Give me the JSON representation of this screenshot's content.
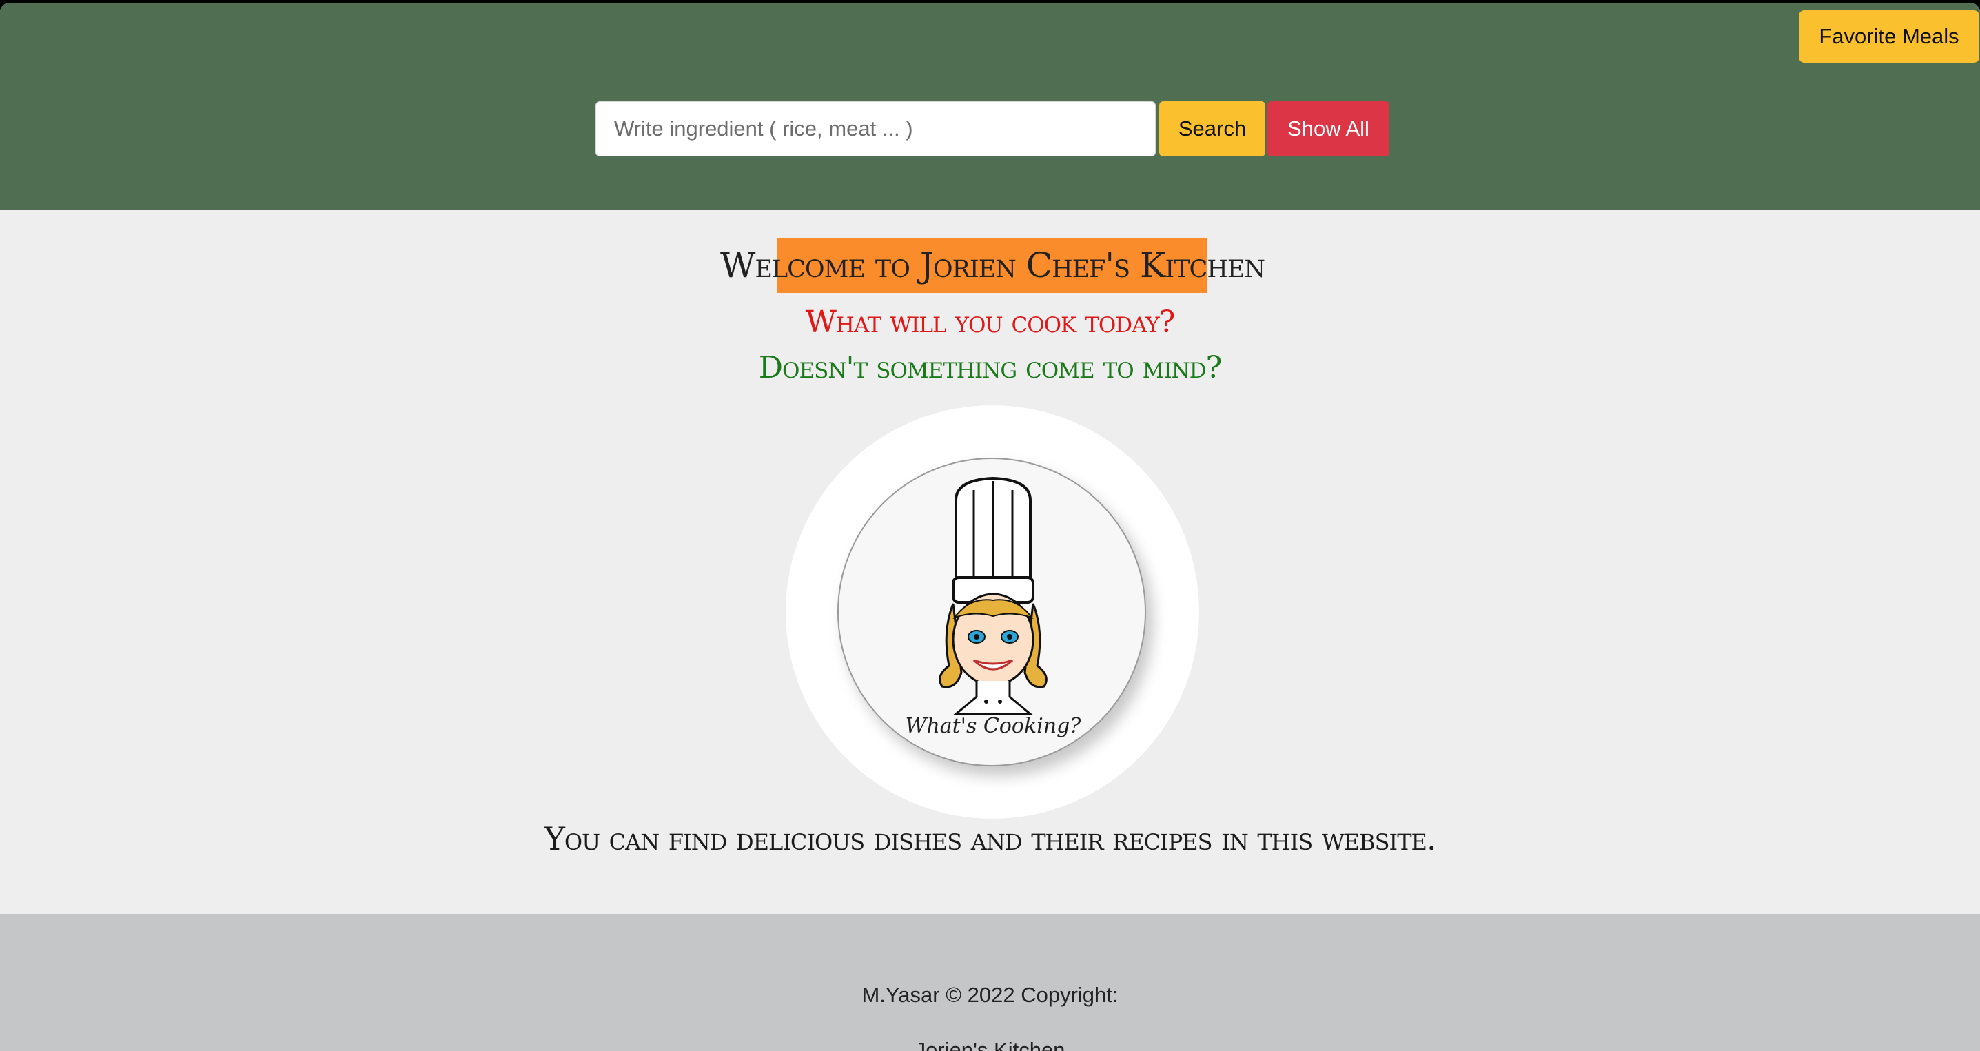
{
  "header": {
    "favorite_button": "Favorite Meals",
    "search_placeholder": "Write ingredient ( rice, meat ... )",
    "search_button": "Search",
    "show_all_button": "Show All"
  },
  "main": {
    "welcome_title": "Welcome to Jorien Chef's Kitchen",
    "question_1": "What will you cook today?",
    "question_2": "Doesn't something come to mind?",
    "logo_caption": "What's Cooking?",
    "tagline": "You can find delicious dishes and their recipes in this website."
  },
  "footer": {
    "copyright": "M.Yasar © 2022 Copyright:",
    "site_link": "Jorien's Kitchen"
  },
  "colors": {
    "header_bg": "#506e51",
    "warning": "#fbc02d",
    "danger": "#dc3545",
    "welcome_bg": "#fb8c2c",
    "question_1": "#e01818",
    "question_2": "#1a7a1a",
    "footer_bg": "#c5c6c8"
  }
}
